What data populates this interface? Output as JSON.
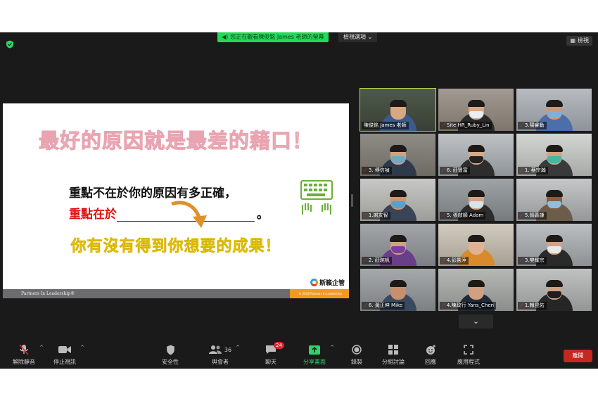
{
  "colors": {
    "window_bg": "#1a1a1a",
    "share_green": "#23d959",
    "leave_red": "#c4281f",
    "active_speaker": "#b8e44a",
    "slide_title": "#f3c2cc",
    "slide_emphasis": "#e01010",
    "slide_yellow": "#f7e52a"
  },
  "top_bar": {
    "share_banner": "您正在觀看陳俊銘 James 老師的螢幕",
    "view_options": "檢視選項 ⌄",
    "view_button": "檢視"
  },
  "slide": {
    "title": "最好的原因就是最差的藉口！",
    "line1": "重點不在於你的原因有多正確，",
    "line2_prefix": "重點在於",
    "line2_suffix": "。",
    "line3": "你有沒有得到你想要的成果！",
    "footer_left": "Partners In Leadership®",
    "footer_right": "© 2018 Partners In Leadership",
    "logo_text": "斯籟企管"
  },
  "participants": [
    {
      "name": "陳俊銘 James 老師",
      "muted": false,
      "active": true
    },
    {
      "name": "Site HR_Ruby_Lin",
      "muted": true,
      "active": false
    },
    {
      "name": "3.陽睿勳",
      "muted": true,
      "active": false
    },
    {
      "name": "3. 傅信禎",
      "muted": true,
      "active": false
    },
    {
      "name": "6. 莊豐富",
      "muted": true,
      "active": false
    },
    {
      "name": "1. 蔡宗瀚",
      "muted": true,
      "active": false
    },
    {
      "name": "1.謝友智",
      "muted": true,
      "active": false
    },
    {
      "name": "5. 張啟順 Adam",
      "muted": true,
      "active": false
    },
    {
      "name": "5.顏義謙",
      "muted": true,
      "active": false
    },
    {
      "name": "2. 莊琬帆",
      "muted": true,
      "active": false
    },
    {
      "name": "4.彭蕙萍",
      "muted": true,
      "active": false
    },
    {
      "name": "3.樊耀宗",
      "muted": true,
      "active": false
    },
    {
      "name": "6. 黃正坤 Mike",
      "muted": true,
      "active": false
    },
    {
      "name": "4.陳政行 Yans_Chen",
      "muted": true,
      "active": false
    },
    {
      "name": "1.賴昆佑",
      "muted": true,
      "active": false
    }
  ],
  "toolbar": {
    "unmute": "解除靜音",
    "stop_video": "停止視訊",
    "security": "安全性",
    "participants_label": "與會者",
    "participants_count": "36",
    "chat": "聊天",
    "chat_badge": "24",
    "share_screen": "分享畫面",
    "record": "錄製",
    "breakout": "分組討論",
    "reactions": "回應",
    "apps": "應用程式",
    "leave": "離開"
  }
}
